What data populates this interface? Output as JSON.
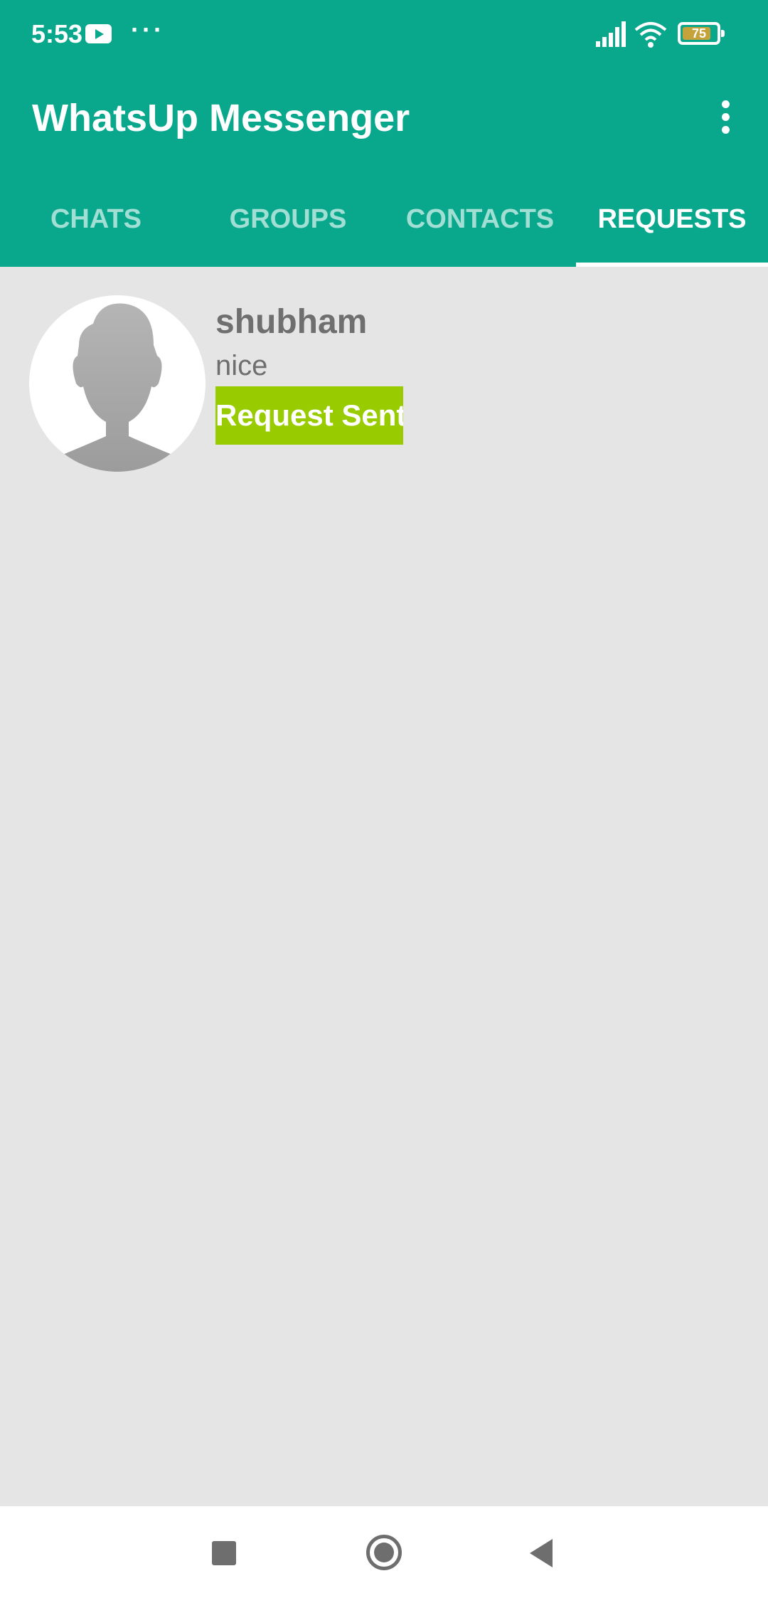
{
  "status_bar": {
    "time": "5:53",
    "battery_level": "75",
    "battery_fraction": 0.75,
    "icons": [
      "youtube-icon",
      "more-dots-icon",
      "signal-icon",
      "wifi-icon",
      "battery-icon"
    ]
  },
  "app_bar": {
    "title": "WhatsUp Messenger",
    "menu_icon": "more-vert-icon"
  },
  "tabs": [
    {
      "label": "CHATS",
      "active": false
    },
    {
      "label": "GROUPS",
      "active": false
    },
    {
      "label": "CONTACTS",
      "active": false
    },
    {
      "label": "REQUESTS",
      "active": true
    }
  ],
  "requests": [
    {
      "name": "shubham",
      "status": "nice",
      "button_label": "Request Sent",
      "avatar_icon": "default-profile-avatar"
    }
  ],
  "nav_bar": {
    "icons": [
      "recent-apps-icon",
      "home-icon",
      "back-icon"
    ]
  },
  "colors": {
    "primary": "#09a88d",
    "request_button": "#98cc00",
    "background": "#e5e5e5",
    "text_secondary": "#6f6f6f"
  }
}
